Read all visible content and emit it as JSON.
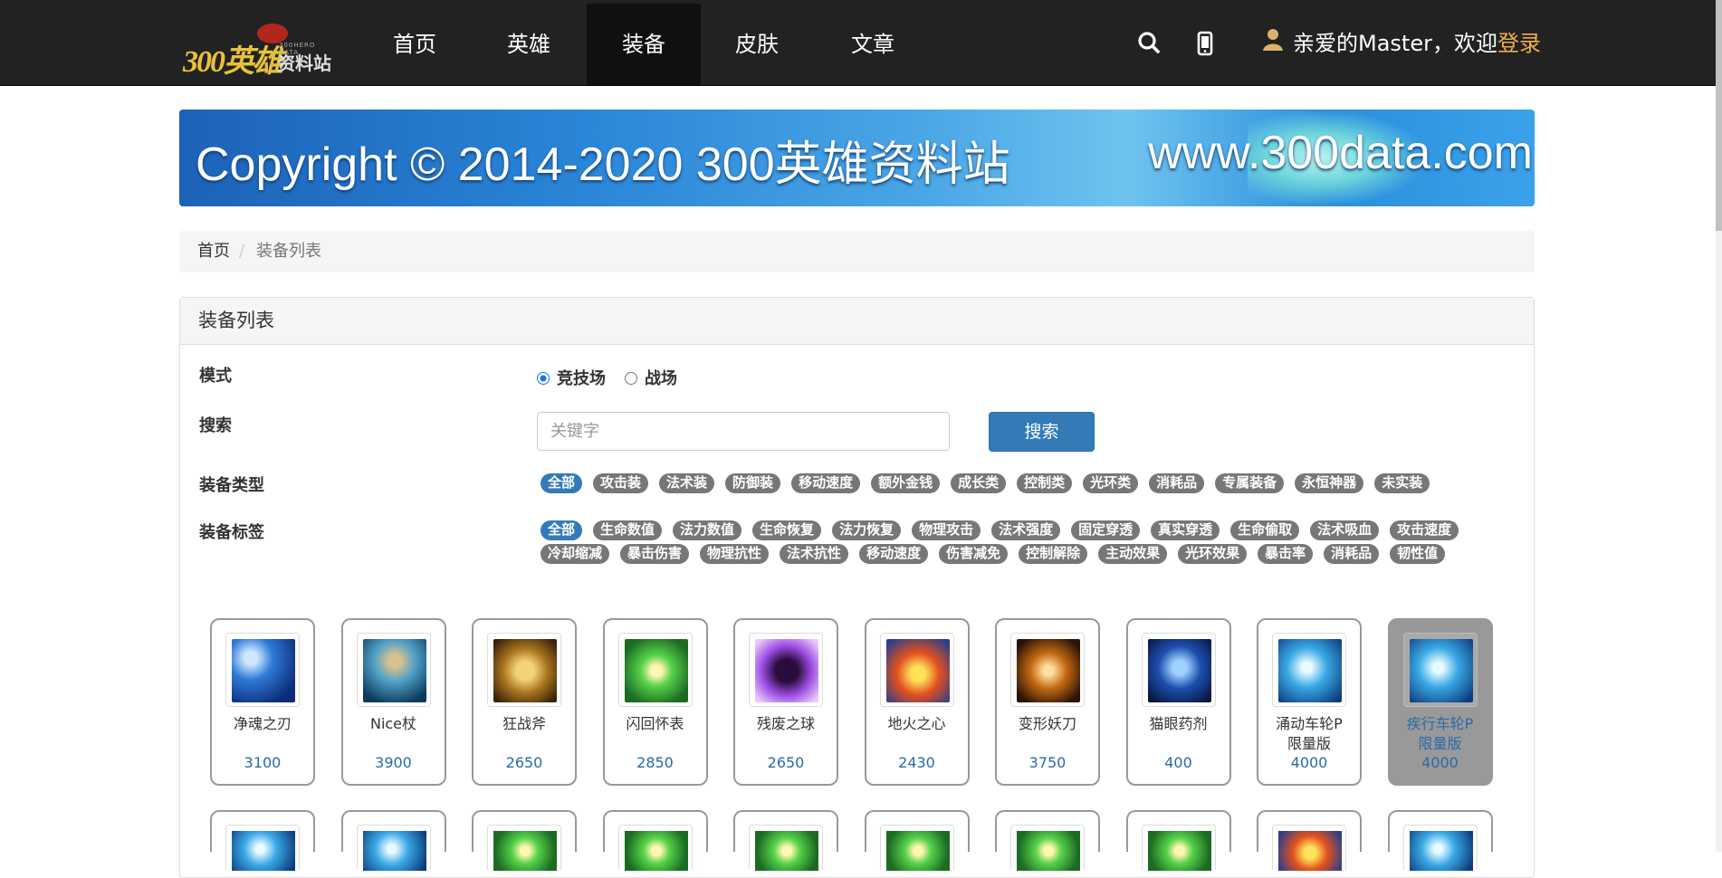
{
  "colors": {
    "navbar": "#222222",
    "active_nav": "#101010",
    "primary": "#337ab7",
    "login": "#f0ad4e",
    "tag_default": "#777777"
  },
  "logo": {
    "text_main": "300英雄",
    "text_sub": "资料站",
    "text_small": "300HERO DATA"
  },
  "nav": {
    "items": [
      {
        "label": "首页",
        "active": false
      },
      {
        "label": "英雄",
        "active": false
      },
      {
        "label": "装备",
        "active": true
      },
      {
        "label": "皮肤",
        "active": false
      },
      {
        "label": "文章",
        "active": false
      }
    ],
    "search_icon": "search-icon",
    "mobile_icon": "mobile-icon",
    "user_icon": "user-icon",
    "greeting": "亲爱的Master，欢迎",
    "login_label": "登录"
  },
  "banner": {
    "text": "Copyright © 2014-2020 300英雄资料站",
    "url": "www.300data.com"
  },
  "breadcrumb": {
    "home": "首页",
    "separator": "/",
    "current": "装备列表"
  },
  "panel": {
    "title": "装备列表",
    "mode_label": "模式",
    "mode_options": [
      {
        "label": "竞技场",
        "checked": true
      },
      {
        "label": "战场",
        "checked": false
      }
    ],
    "search_label": "搜索",
    "search_placeholder": "关键字",
    "search_value": "",
    "search_button": "搜索",
    "type_label": "装备类型",
    "types": [
      "全部",
      "攻击装",
      "法术装",
      "防御装",
      "移动速度",
      "额外金钱",
      "成长类",
      "控制类",
      "光环类",
      "消耗品",
      "专属装备",
      "永恒神器",
      "未实装"
    ],
    "tag_label": "装备标签",
    "tags": [
      "全部",
      "生命数值",
      "法力数值",
      "生命恢复",
      "法力恢复",
      "物理攻击",
      "法术强度",
      "固定穿透",
      "真实穿透",
      "生命偷取",
      "法术吸血",
      "攻击速度",
      "冷却缩减",
      "暴击伤害",
      "物理抗性",
      "法术抗性",
      "移动速度",
      "伤害减免",
      "控制解除",
      "主动效果",
      "光环效果",
      "暴击率",
      "消耗品",
      "韧性值"
    ]
  },
  "items": [
    {
      "name": "净魂之刃",
      "price": "3100",
      "icon": "blade-icon"
    },
    {
      "name": "Nice杖",
      "price": "3900",
      "icon": "staff-icon"
    },
    {
      "name": "狂战斧",
      "price": "2650",
      "icon": "axe-icon"
    },
    {
      "name": "闪回怀表",
      "price": "2850",
      "icon": "pocket-watch-icon"
    },
    {
      "name": "残废之球",
      "price": "2650",
      "icon": "orb-icon"
    },
    {
      "name": "地火之心",
      "price": "2430",
      "icon": "fire-heart-icon"
    },
    {
      "name": "变形妖刀",
      "price": "3750",
      "icon": "demon-sword-icon"
    },
    {
      "name": "猫眼药剂",
      "price": "400",
      "icon": "potion-icon"
    },
    {
      "name": "涌动车轮P限量版",
      "price": "4000",
      "icon": "wheel-icon"
    },
    {
      "name": "疾行车轮P限量版",
      "price": "4000",
      "icon": "wheel-icon",
      "selected": true
    }
  ]
}
